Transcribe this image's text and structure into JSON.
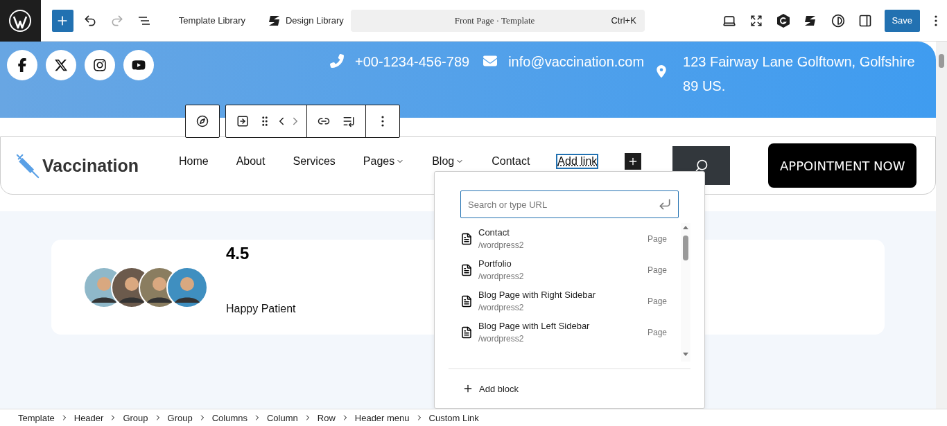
{
  "toolbar": {
    "links": [
      "Template Library",
      "Design Library"
    ],
    "command": {
      "title": "Front Page · Template",
      "shortcut": "Ctrl+K"
    },
    "save": "Save"
  },
  "contact_bar": {
    "phone": "+00-1234-456-789",
    "email": "info@vaccination.com",
    "address": "123 Fairway Lane Golftown, Golfshire 89 US."
  },
  "header": {
    "logo": "Vaccination",
    "nav": [
      {
        "label": "Home",
        "dropdown": false,
        "selected": false
      },
      {
        "label": "About",
        "dropdown": false,
        "selected": false
      },
      {
        "label": "Services",
        "dropdown": false,
        "selected": false
      },
      {
        "label": "Pages",
        "dropdown": true,
        "selected": false
      },
      {
        "label": "Blog",
        "dropdown": true,
        "selected": false
      },
      {
        "label": "Contact",
        "dropdown": false,
        "selected": false
      },
      {
        "label": "Add link",
        "dropdown": false,
        "selected": true
      }
    ],
    "cta": "APPOINTMENT NOW"
  },
  "stats": {
    "rating": "4.5",
    "label": "Happy Patient"
  },
  "link_popover": {
    "placeholder": "Search or type URL",
    "results": [
      {
        "title": "Contact",
        "url": "/wordpress2",
        "type": "Page"
      },
      {
        "title": "Portfolio",
        "url": "/wordpress2",
        "type": "Page"
      },
      {
        "title": "Blog Page with Right Sidebar",
        "url": "/wordpress2",
        "type": "Page"
      },
      {
        "title": "Blog Page with Left Sidebar",
        "url": "/wordpress2",
        "type": "Page"
      }
    ],
    "add_block": "Add block"
  },
  "breadcrumbs": [
    "Template",
    "Header",
    "Group",
    "Group",
    "Columns",
    "Column",
    "Row",
    "Header menu",
    "Custom Link"
  ]
}
